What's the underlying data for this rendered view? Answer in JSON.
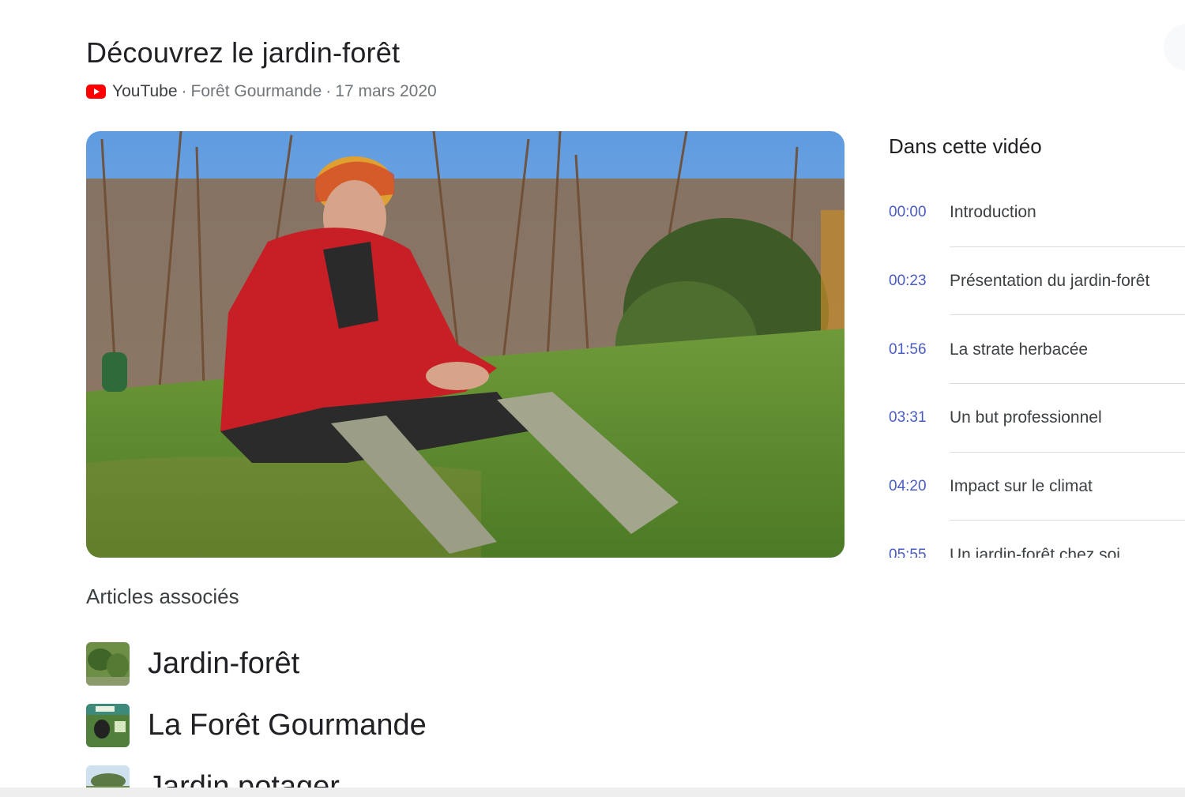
{
  "header": {
    "title": "Découvrez le jardin-forêt",
    "source": "YouTube",
    "channel": "Forêt Gourmande",
    "date": "17 mars 2020",
    "separator": "·"
  },
  "video": {
    "thumbnail_icon": "video-thumbnail-man-sitting-in-garden"
  },
  "chapters": {
    "title": "Dans cette vidéo",
    "items": [
      {
        "time": "00:00",
        "label": "Introduction"
      },
      {
        "time": "00:23",
        "label": "Présentation du jardin-forêt"
      },
      {
        "time": "01:56",
        "label": "La strate herbacée"
      },
      {
        "time": "03:31",
        "label": "Un but professionnel"
      },
      {
        "time": "04:20",
        "label": "Impact sur le climat"
      },
      {
        "time": "05:55",
        "label": "Un jardin-forêt chez soi"
      }
    ]
  },
  "related": {
    "title": "Articles associés",
    "items": [
      {
        "name": "Jardin-forêt"
      },
      {
        "name": "La Forêt Gourmande"
      },
      {
        "name": "Jardin potager"
      }
    ]
  },
  "colors": {
    "youtube_red": "#ff0000",
    "timestamp_blue": "#4a5bc4",
    "text_primary": "#202124",
    "text_secondary": "#70757a"
  }
}
